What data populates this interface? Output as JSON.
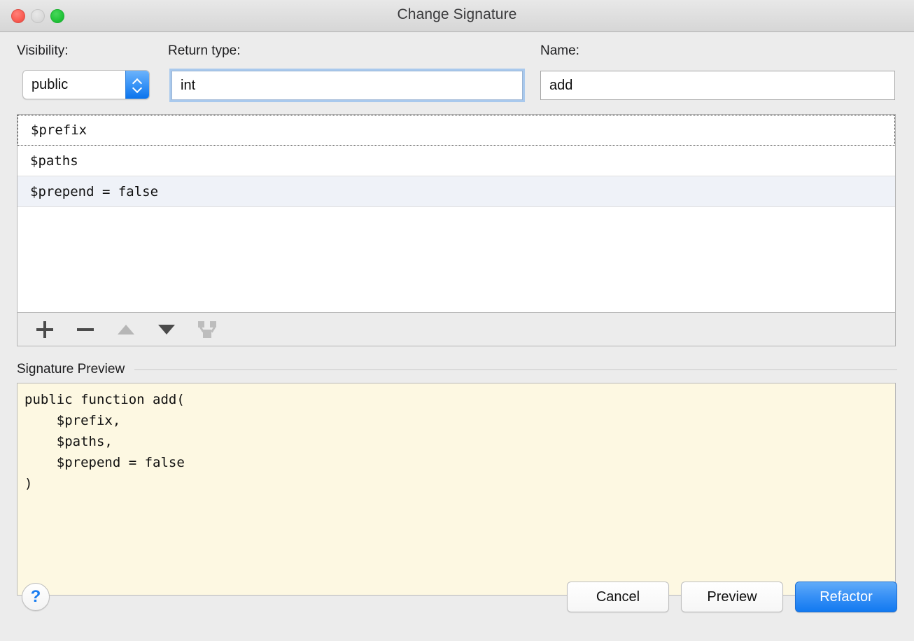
{
  "window": {
    "title": "Change Signature",
    "traffic_lights": [
      "close",
      "minimize",
      "zoom"
    ]
  },
  "form": {
    "visibility_label": "Visibility:",
    "visibility_value": "public",
    "return_type_label": "Return type:",
    "return_type_value": "int",
    "name_label": "Name:",
    "name_value": "add"
  },
  "parameters": {
    "rows": [
      {
        "text": "$prefix",
        "focused": true,
        "selected": false
      },
      {
        "text": "$paths",
        "focused": false,
        "selected": false
      },
      {
        "text": "$prepend = false",
        "focused": false,
        "selected": true
      }
    ],
    "toolbar": [
      {
        "name": "add-parameter-button",
        "icon": "plus-icon",
        "enabled": true
      },
      {
        "name": "remove-parameter-button",
        "icon": "minus-icon",
        "enabled": true
      },
      {
        "name": "move-parameter-up-button",
        "icon": "triangle-up-icon",
        "enabled": false
      },
      {
        "name": "move-parameter-down-button",
        "icon": "triangle-down-icon",
        "enabled": true
      },
      {
        "name": "propagate-parameters-button",
        "icon": "fork-icon",
        "enabled": false
      }
    ]
  },
  "signature_preview": {
    "title": "Signature Preview",
    "code": "public function add(\n    $prefix,\n    $paths,\n    $prepend = false\n)"
  },
  "footer": {
    "help_label": "?",
    "cancel_label": "Cancel",
    "preview_label": "Preview",
    "refactor_label": "Refactor"
  },
  "colors": {
    "accent_blue": "#1279f0",
    "window_background": "#ececec",
    "preview_background": "#fdf8e2",
    "selected_row": "#eff2f8",
    "traffic_close": "#fb5f55",
    "traffic_minimize": "#dcdcdc",
    "traffic_zoom": "#25c63c"
  }
}
